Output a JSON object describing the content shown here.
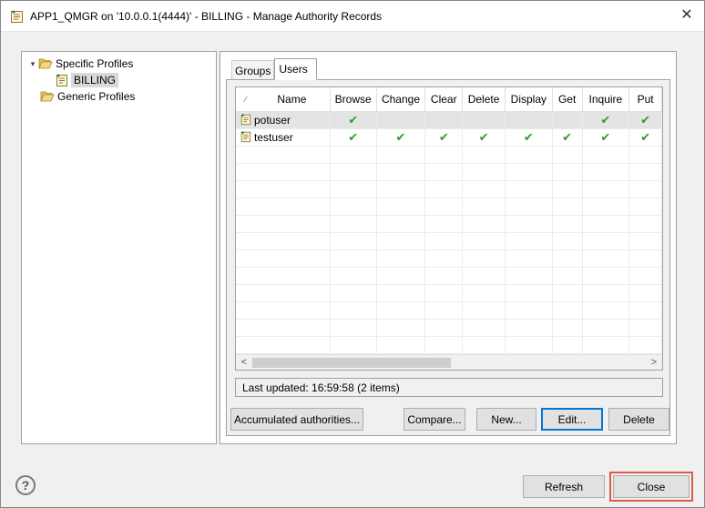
{
  "window": {
    "title": "APP1_QMGR on '10.0.0.1(4444)' - BILLING - Manage Authority Records",
    "close_glyph": "✕"
  },
  "tree": {
    "items": [
      {
        "label": "Specific Profiles",
        "expanded": true,
        "icon": "folder-open-icon"
      },
      {
        "label": "BILLING",
        "selected": true,
        "icon": "profile-icon"
      },
      {
        "label": "Generic Profiles",
        "icon": "folder-open-icon"
      }
    ],
    "expand_glyph": "▾"
  },
  "tabs": [
    {
      "label": "Groups",
      "active": false
    },
    {
      "label": "Users",
      "active": true
    }
  ],
  "table": {
    "sort_marker": "⁄",
    "columns": [
      "Name",
      "Browse",
      "Change",
      "Clear",
      "Delete",
      "Display",
      "Get",
      "Inquire",
      "Put"
    ],
    "rows": [
      {
        "name": "potuser",
        "selected": true,
        "checks": [
          true,
          false,
          false,
          false,
          false,
          false,
          true,
          true
        ]
      },
      {
        "name": "testuser",
        "selected": false,
        "checks": [
          true,
          true,
          true,
          true,
          true,
          true,
          true,
          true
        ]
      }
    ],
    "check_glyph": "✔",
    "scroll_left": "<",
    "scroll_right": ">"
  },
  "status": {
    "text": "Last updated: 16:59:58 (2 items)"
  },
  "buttons": {
    "accumulated": "Accumulated authorities...",
    "compare": "Compare...",
    "new": "New...",
    "edit": "Edit...",
    "delete": "Delete",
    "refresh": "Refresh",
    "close": "Close",
    "help": "?"
  },
  "colors": {
    "check": "#2e9c2e",
    "close_highlight": "#e05a4a",
    "focus": "#0078d7"
  }
}
